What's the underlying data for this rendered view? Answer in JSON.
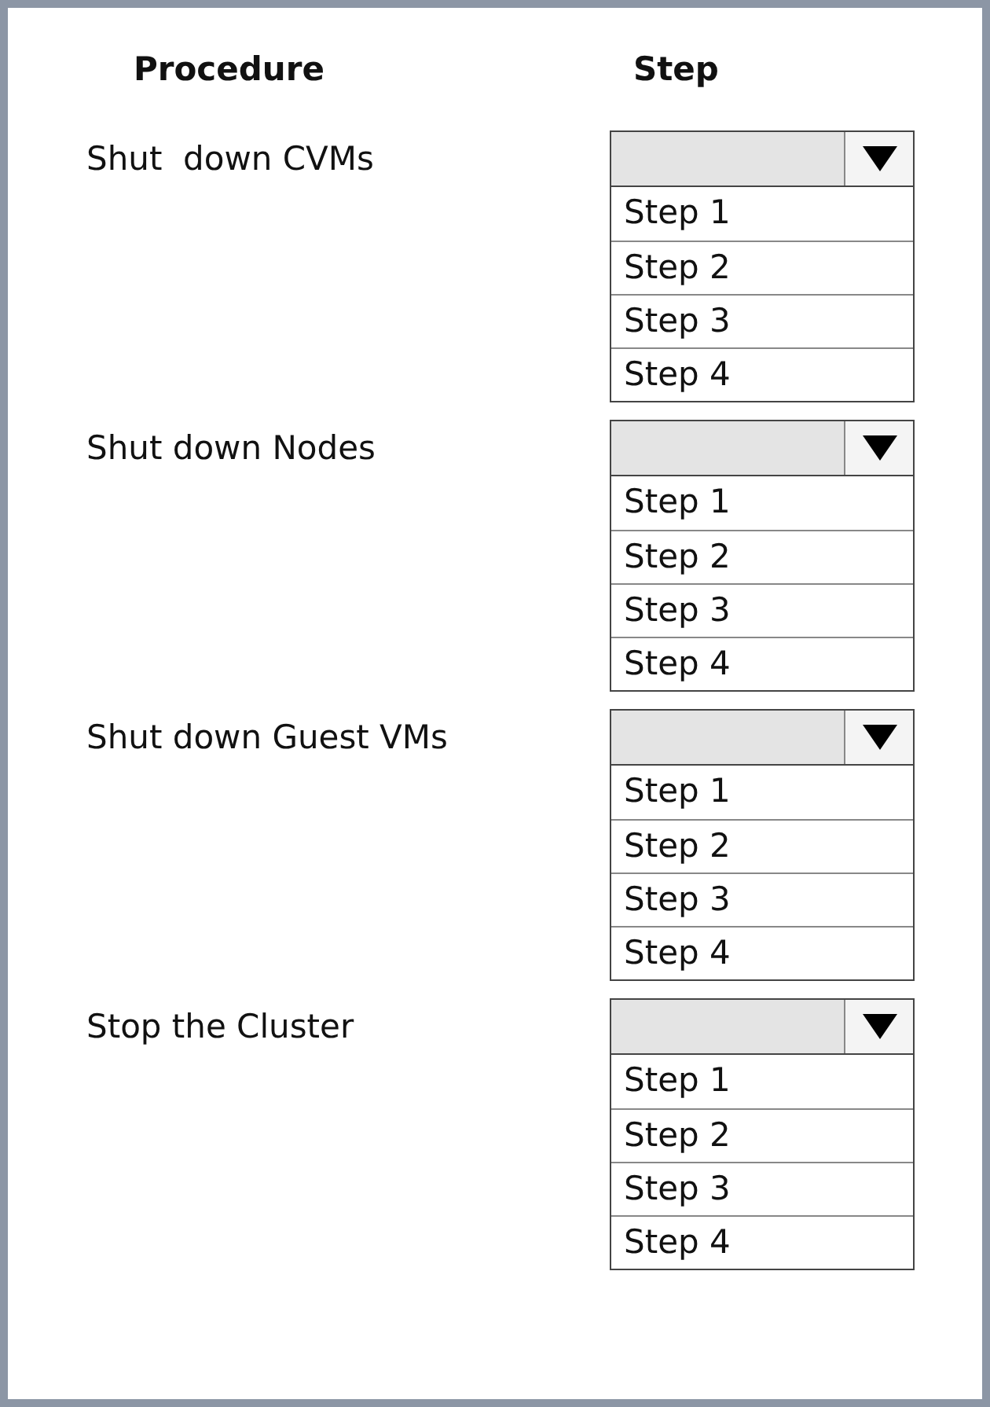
{
  "headers": {
    "procedure": "Procedure",
    "step": "Step"
  },
  "rows": [
    {
      "label": "Shut  down CVMs",
      "options": [
        "Step 1",
        "Step 2",
        "Step 3",
        "Step 4"
      ]
    },
    {
      "label": "Shut down Nodes",
      "options": [
        "Step 1",
        "Step 2",
        "Step 3",
        "Step 4"
      ]
    },
    {
      "label": "Shut down Guest VMs",
      "options": [
        "Step 1",
        "Step 2",
        "Step 3",
        "Step 4"
      ]
    },
    {
      "label": "Stop the Cluster",
      "options": [
        "Step 1",
        "Step 2",
        "Step 3",
        "Step 4"
      ]
    }
  ]
}
